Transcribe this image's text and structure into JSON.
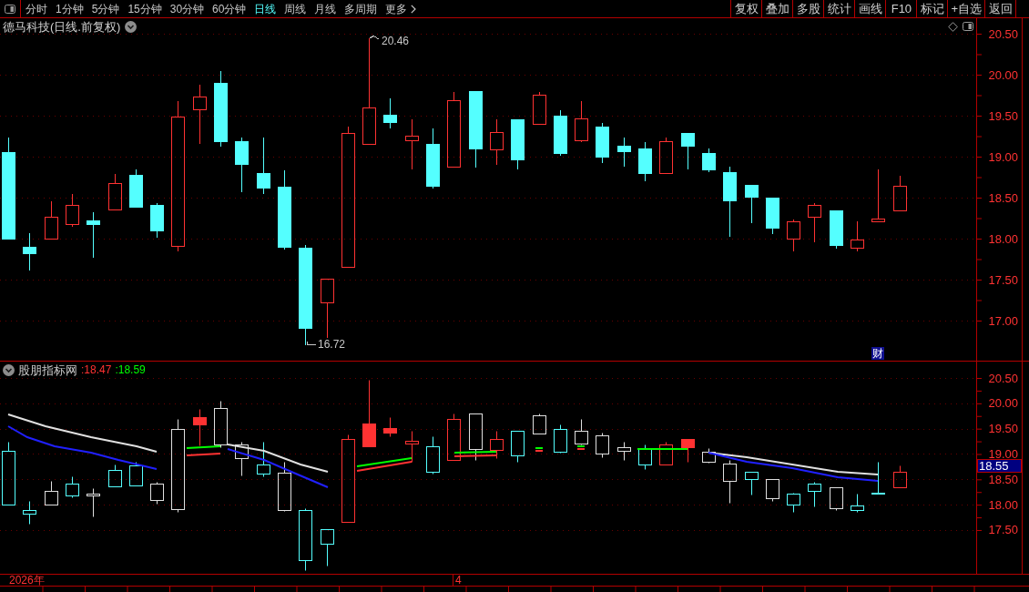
{
  "toolbar": {
    "periods": [
      {
        "label": "分时",
        "selected": false
      },
      {
        "label": "1分钟",
        "selected": false
      },
      {
        "label": "5分钟",
        "selected": false
      },
      {
        "label": "15分钟",
        "selected": false
      },
      {
        "label": "30分钟",
        "selected": false
      },
      {
        "label": "60分钟",
        "selected": false
      },
      {
        "label": "日线",
        "selected": true
      },
      {
        "label": "周线",
        "selected": false
      },
      {
        "label": "月线",
        "selected": false
      },
      {
        "label": "多周期",
        "selected": false
      }
    ],
    "more": "更多",
    "actions": [
      "复权",
      "叠加",
      "多股",
      "统计",
      "画线",
      "F10",
      "标记",
      "+自选",
      "返回"
    ]
  },
  "price_chart": {
    "title": "德马科技(日线.前复权)",
    "high_label": "20.46",
    "low_label": "16.72",
    "finance_badge": "财",
    "axis_labels": [
      "20.50",
      "20.00",
      "19.50",
      "19.00",
      "18.50",
      "18.00",
      "17.50",
      "17.00"
    ]
  },
  "indicator": {
    "name": "股朋指标网",
    "values": [
      {
        "text": ":18.47",
        "color": "#ff3232"
      },
      {
        "text": ":18.59",
        "color": "#00ff00"
      }
    ],
    "axis_labels": [
      "20.50",
      "20.00",
      "19.50",
      "19.00",
      "18.50",
      "18.00",
      "17.50"
    ],
    "current_price": "18.55"
  },
  "time_axis": {
    "labels": [
      "2026年",
      "4"
    ]
  }
}
